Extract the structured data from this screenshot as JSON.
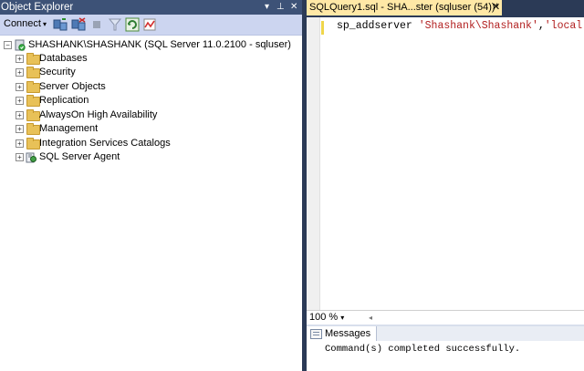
{
  "object_explorer": {
    "title": "Object Explorer",
    "controls": {
      "dropdown": "▾",
      "pin": "⊥",
      "close": "✕"
    },
    "toolbar": {
      "connect_label": "Connect",
      "connect_arrow": "▾"
    },
    "server_node": "SHASHANK\\SHASHANK (SQL Server 11.0.2100 - sqluser)",
    "children": [
      "Databases",
      "Security",
      "Server Objects",
      "Replication",
      "AlwaysOn High Availability",
      "Management",
      "Integration Services Catalogs",
      "SQL Server Agent"
    ]
  },
  "query_editor": {
    "tab_title": "SQLQuery1.sql - SHA...ster (sqluser (54))*",
    "tab_close": "✕",
    "code": {
      "keyword": "sp_addserver",
      "arg1": "'Shashank\\Shashank'",
      "comma": ",",
      "arg2": "'local'",
      "terminator": ";"
    },
    "zoom": "100 %",
    "zoom_arrow": "▾",
    "scroll_left": "◂"
  },
  "results": {
    "tab_label": "Messages",
    "message": "Command(s) completed successfully."
  },
  "colors": {
    "frame": "#2b3a56",
    "titlebar": "#3d5277",
    "toolbar": "#ccd5f0",
    "active_tab": "#ffe8a6",
    "string": "#b22020",
    "folder": "#e8c158"
  }
}
